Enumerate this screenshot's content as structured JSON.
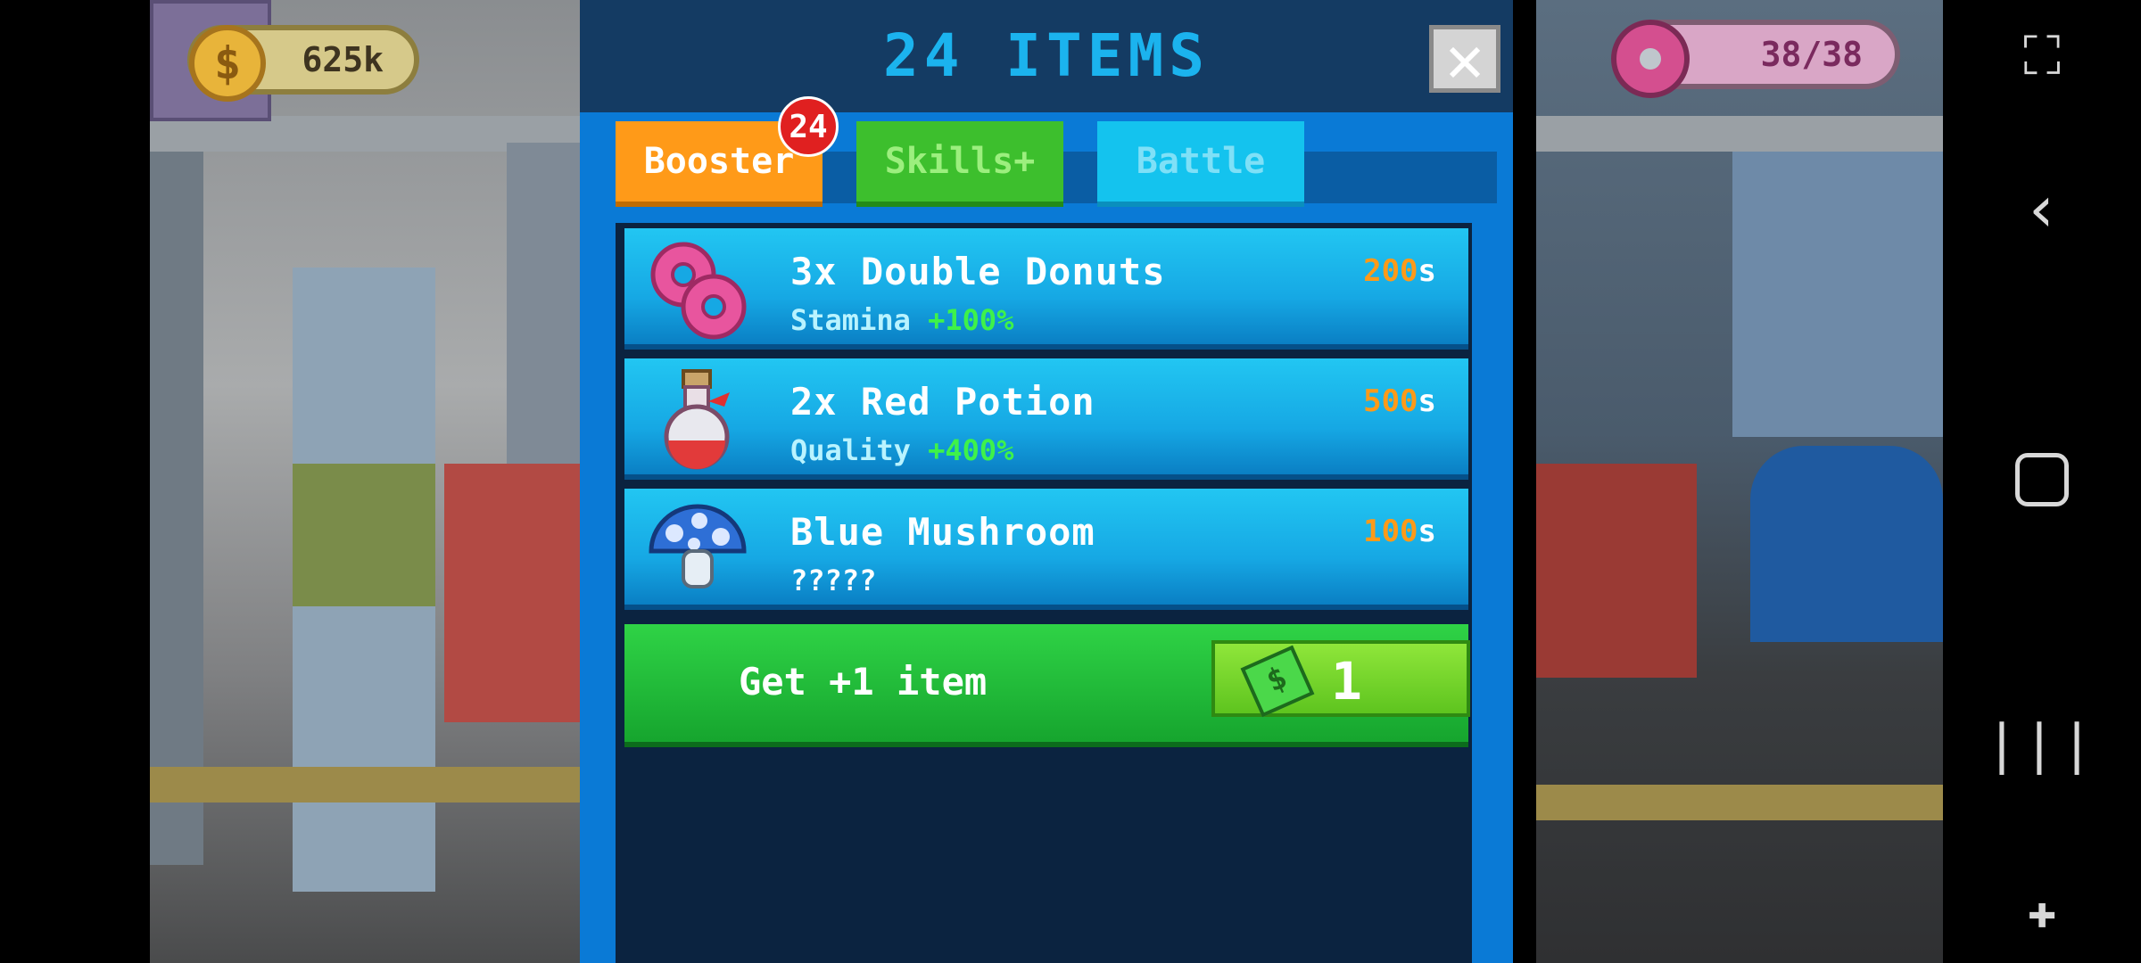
{
  "status_bar": {
    "money": "625k",
    "money_icon": "$",
    "stamina": "38/38"
  },
  "modal": {
    "title": "24 ITEMS",
    "close_glyph": "✕",
    "tabs": [
      {
        "label": "Booster",
        "badge": "24"
      },
      {
        "label": "Skills+"
      },
      {
        "label": "Battle"
      }
    ],
    "items": [
      {
        "name": "3x Double Donuts",
        "desc_label": "Stamina",
        "desc_bonus": "+100%",
        "time": "200",
        "unit": "s",
        "icon": "donut-icon"
      },
      {
        "name": "2x Red Potion",
        "desc_label": "Quality",
        "desc_bonus": "+400%",
        "time": "500",
        "unit": "s",
        "icon": "potion-icon"
      },
      {
        "name": "Blue Mushroom",
        "desc_label": "?????",
        "desc_bonus": "",
        "time": "100",
        "unit": "s",
        "icon": "mushroom-icon"
      }
    ],
    "get_item": {
      "label": "Get +1 item",
      "cost": "1",
      "cost_icon": "cash-icon"
    }
  },
  "navbar": {
    "screenshot_icon": "⛶",
    "back_icon": "‹",
    "recent_icon": "|||",
    "game_icon": "✚"
  },
  "colors": {
    "accent": "#1bb3ee",
    "booster": "#ff9a18",
    "skills": "#3dbf2d",
    "battle": "#14c3ee",
    "bonus_green": "#3ef24a"
  }
}
